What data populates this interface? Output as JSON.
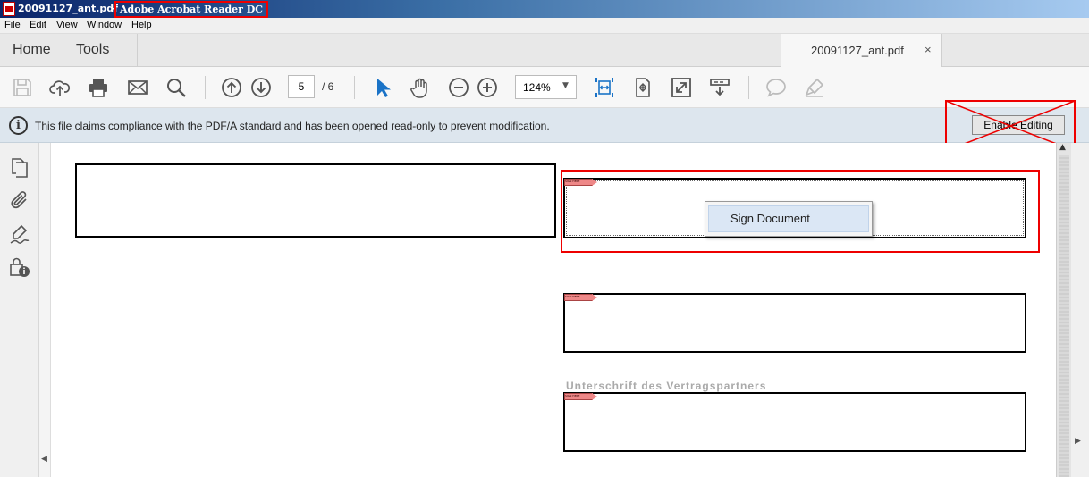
{
  "window": {
    "filename": "20091127_ant.pdf",
    "separator": "-",
    "app_name": "Adobe Acrobat Reader DC"
  },
  "menu": {
    "items": [
      "File",
      "Edit",
      "View",
      "Window",
      "Help"
    ]
  },
  "nav": {
    "home": "Home",
    "tools": "Tools",
    "doc_tab": "20091127_ant.pdf",
    "close_glyph": "×"
  },
  "toolbar": {
    "page_current": "5",
    "page_total": "/ 6",
    "zoom": "124%",
    "zoom_caret": "▼",
    "icons": [
      "save-icon",
      "cloud-upload-icon",
      "print-icon",
      "email-icon",
      "search-icon",
      "page-up-icon",
      "page-down-icon",
      "select-cursor-icon",
      "hand-icon",
      "zoom-out-icon",
      "zoom-in-icon",
      "fit-width-icon",
      "scrolling-mode-icon",
      "full-screen-icon",
      "read-mode-icon",
      "comment-icon",
      "highlight-icon"
    ]
  },
  "infobar": {
    "icon_glyph": "i",
    "message": "This file claims compliance with the PDF/A standard and has been opened read-only to prevent modification.",
    "enable_button": "Enable Editing"
  },
  "sidepanel": {
    "icons": [
      "pages-icon",
      "attachments-icon",
      "signatures-icon",
      "security-info-icon"
    ]
  },
  "document": {
    "signature_tag_text": "SIGN HERE",
    "context_menu": {
      "item": "Sign Document"
    },
    "ghost_text": "Unterschrift des Vertragspartners"
  },
  "scroll": {
    "up_arrow": "▲",
    "left_arrow": "◀",
    "right_arrow": "▶"
  },
  "colors": {
    "annotation_red": "#e00000",
    "infobar_bg": "#dde6ee",
    "signature_tag": "#e88888",
    "accent_blue": "#1a73c7"
  }
}
